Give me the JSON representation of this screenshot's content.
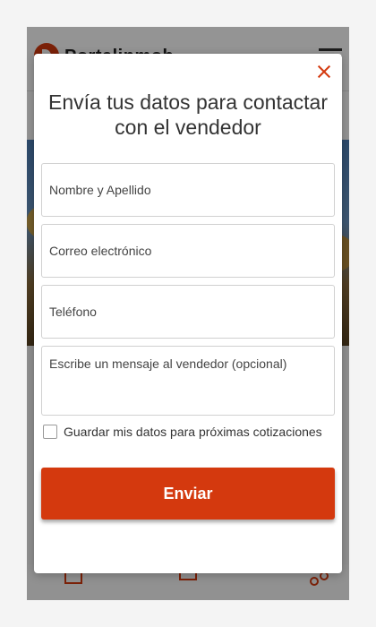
{
  "app": {
    "logo_text": "Portalinmob",
    "menu_icon": "hamburger-icon",
    "bottom_icons": [
      "download-icon",
      "print-icon",
      "share-icon"
    ]
  },
  "modal": {
    "title": "Envía tus datos para contactar con el vendedor",
    "close_icon": "close-icon",
    "fields": {
      "name_placeholder": "Nombre y Apellido",
      "email_placeholder": "Correo electrónico",
      "phone_placeholder": "Teléfono",
      "message_placeholder": "Escribe un mensaje al vendedor (opcional)"
    },
    "save_checkbox_label": "Guardar mis datos para próximas cotizaciones",
    "save_checkbox_checked": false,
    "submit_label": "Enviar"
  },
  "colors": {
    "accent": "#d4390e",
    "overlay": "rgba(0,0,0,0.42)",
    "text": "#333333"
  }
}
